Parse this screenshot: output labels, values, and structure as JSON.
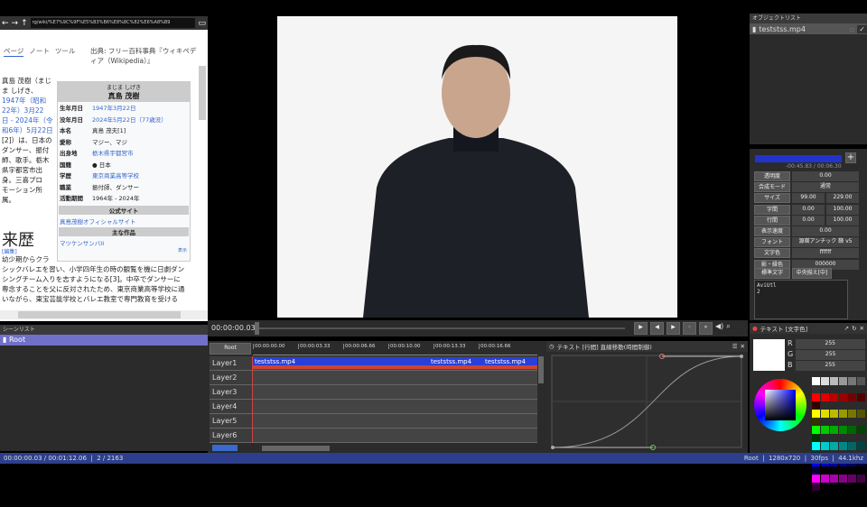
{
  "browser": {
    "url": "rg/wiki/%E7%9C%9F%E5%B3%B6%E8%8C%82%E6%A8%B9",
    "tabs": [
      "ページ",
      "ノート",
      "ツール"
    ],
    "source": "出典: フリー百科事典『ウィキペディア（Wikipedia）』",
    "lead": [
      "真島 茂樹（まじ",
      "ま しげき、",
      "1947年（昭和",
      "22年）3月22",
      "日 - 2024年（令",
      "和6年）5月22日",
      "[2]）は、日本の",
      "ダンサー、振付",
      "師、歌手。栃木",
      "県宇都宮市出",
      "身。三喜プロ",
      "モーション所",
      "属。"
    ],
    "infobox": {
      "ruby": "まじま しげき",
      "name": "真島 茂樹",
      "rows": [
        [
          "生年月日",
          "1947年3月22日"
        ],
        [
          "没年月日",
          "2024年5月22日（77歳没）"
        ],
        [
          "本名",
          "真島 茂夫[1]"
        ],
        [
          "愛称",
          "マジー、マジ"
        ],
        [
          "出身地",
          "栃木県宇都宮市"
        ],
        [
          "国籍",
          "● 日本"
        ],
        [
          "学歴",
          "東京商業高等学校"
        ],
        [
          "職業",
          "振付師、ダンサー"
        ],
        [
          "活動期間",
          "1964年 - 2024年"
        ]
      ],
      "official_header": "公式サイト",
      "official_link": "真島茂樹オフィシャルサイト",
      "works_header": "主な作品",
      "works": "マツケンサンバII",
      "more": "表示"
    },
    "section": "来歴",
    "edit": "[編集]",
    "body": [
      "幼少期からクラ",
      "シックバレエを習い、小学四年生の時の観覧を機に日劇ダン",
      "シングチーム入りを志すようになる[3]。中卒でダンサーに",
      "専念することを父に反対されたため、東京商業高等学校に通",
      "いながら、東宝芸能学校とバレエ教室で専門教育を受ける"
    ]
  },
  "object_list": {
    "title": "オブジェクトリスト",
    "items": [
      {
        "name": "teststss.mp4"
      }
    ]
  },
  "properties": {
    "time": "-00:45.83 / 00:06.30",
    "rows": [
      {
        "label": "透明度",
        "values": [
          "0.00"
        ]
      },
      {
        "label": "合成モード",
        "values": [
          "通常"
        ]
      },
      {
        "label": "サイズ",
        "values": [
          "99.00",
          "229.00"
        ]
      },
      {
        "label": "字間",
        "values": [
          "0.00",
          "100.00"
        ]
      },
      {
        "label": "行間",
        "values": [
          "0.00",
          "100.00"
        ]
      },
      {
        "label": "表示速度",
        "values": [
          "0.00"
        ]
      },
      {
        "label": "フォント",
        "values": [
          "源暎アンチック 篩 v5"
        ]
      },
      {
        "label": "文字色",
        "values": [
          "ffffff"
        ]
      },
      {
        "label": "影・縁色",
        "values": [
          "000000"
        ]
      }
    ],
    "std_char": "標準文字",
    "align": "中央揃え[中]",
    "text": "AviUtl\n2"
  },
  "playback": {
    "time": "00:00:00.03"
  },
  "scene_list": {
    "title": "シーンリスト",
    "items": [
      "Root"
    ]
  },
  "timeline": {
    "root": "Root",
    "ticks": [
      "00:00:00.00",
      "00:00:03.33",
      "00:00:06.66",
      "00:00:10.00",
      "00:00:13.33",
      "00:00:16.66"
    ],
    "layers": [
      "Layer1",
      "Layer2",
      "Layer3",
      "Layer4",
      "Layer5",
      "Layer6"
    ],
    "clips": [
      "teststss.mp4",
      "teststss.mp4",
      "teststss.mp4"
    ]
  },
  "graph": {
    "title": "テキスト [行間] 直線移動(時間制御)"
  },
  "color": {
    "title": "テキスト [文字色]",
    "r": "255",
    "g": "255",
    "b": "255",
    "labels": [
      "R",
      "G",
      "B"
    ]
  },
  "status": {
    "left": "00:00:00.03 / 00:01:12.06  |  2 / 2163",
    "right": "Root  |  1280x720  |  30fps  |  44.1khz"
  }
}
